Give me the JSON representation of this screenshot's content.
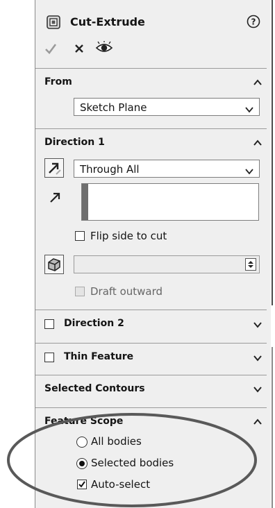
{
  "header": {
    "title": "Cut-Extrude",
    "help_icon": "help-circle-icon"
  },
  "actions": {
    "ok_icon": "checkmark-icon",
    "cancel_icon": "x-icon",
    "preview_icon": "eye-icon"
  },
  "from": {
    "label": "From",
    "selected": "Sketch Plane"
  },
  "direction1": {
    "label": "Direction 1",
    "end_condition": "Through All",
    "flip_label": "Flip side to cut",
    "draft_label": "Draft outward"
  },
  "direction2": {
    "label": "Direction 2"
  },
  "thin_feature": {
    "label": "Thin Feature"
  },
  "selected_contours": {
    "label": "Selected Contours"
  },
  "feature_scope": {
    "label": "Feature Scope",
    "all_bodies": "All bodies",
    "selected_bodies": "Selected bodies",
    "auto_select": "Auto-select",
    "selected_option": "Selected bodies",
    "auto_select_checked": true
  }
}
